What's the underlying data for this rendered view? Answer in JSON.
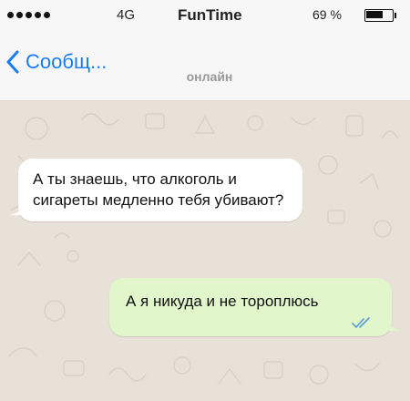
{
  "status_bar": {
    "signal_dots": 5,
    "network": "4G",
    "carrier": "FunTime",
    "battery_percent": "69 %",
    "battery_level": 0.69,
    "icons": [
      "signal-icon",
      "battery-icon"
    ]
  },
  "nav": {
    "back_label": "Сообщ...",
    "presence": "онлайн",
    "accent_color": "#1a7cf3",
    "icons": [
      "chevron-left-icon"
    ]
  },
  "messages": [
    {
      "direction": "incoming",
      "text": "А ты знаешь, что алкоголь и сигареты медленно тебя убивают?",
      "bubble_color": "#ffffff"
    },
    {
      "direction": "outgoing",
      "text": "А я никуда и не тороплюсь",
      "bubble_color": "#e1f7cb",
      "status_icon": "read-double-check-icon",
      "status_color": "#5b9ad8"
    }
  ]
}
